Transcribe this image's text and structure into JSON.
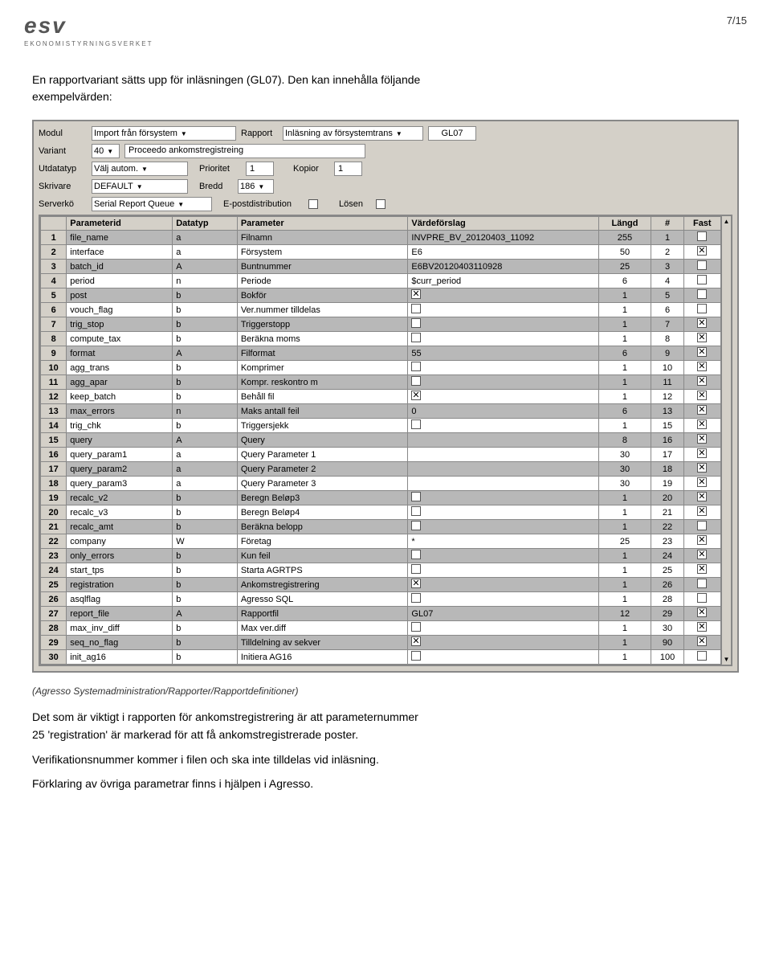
{
  "header": {
    "logo_text": "esv",
    "logo_subtitle": "EKONOMISTYRNINGSVERKET",
    "page_number": "7/15"
  },
  "intro": {
    "line1": "En rapportvariant sätts upp för inläsningen (GL07). Den kan innehålla följande",
    "line2": "exempelvärden:"
  },
  "dialog": {
    "modul_label": "Modul",
    "modul_value": "Import från försystem",
    "rapport_label": "Rapport",
    "rapport_value": "Inläsning av försystemtrans",
    "rapport_code": "GL07",
    "variant_label": "Variant",
    "variant_value": "40",
    "variant_desc": "Proceedo ankomstregistreing",
    "utdatatyp_label": "Utdatatyp",
    "utdatatyp_value": "Välj autom.",
    "prioritet_label": "Prioritet",
    "prioritet_value": "1",
    "kopior_label": "Kopior",
    "kopior_value": "1",
    "skrivare_label": "Skrivare",
    "skrivare_value": "DEFAULT",
    "bredd_label": "Bredd",
    "bredd_value": "186",
    "serverkö_label": "Serverkö",
    "serverkö_value": "Serial Report Queue",
    "epost_label": "E-postdistribution",
    "losen_label": "Lösen"
  },
  "table": {
    "headers": [
      "",
      "Parameterid",
      "Datatyp",
      "Parameter",
      "Värdeförslag",
      "Längd",
      "#",
      "Fast"
    ],
    "rows": [
      {
        "num": "1",
        "paramid": "file_name",
        "dtype": "a",
        "param": "Filnamn",
        "value": "INVPRE_BV_20120403_11092",
        "length": "255",
        "hash": "1",
        "fast": false,
        "dark": true
      },
      {
        "num": "2",
        "paramid": "interface",
        "dtype": "a",
        "param": "Försystem",
        "value": "E6",
        "length": "50",
        "hash": "2",
        "fast": true,
        "dark": false
      },
      {
        "num": "3",
        "paramid": "batch_id",
        "dtype": "A",
        "param": "Buntnummer",
        "value": "E6BV20120403110928",
        "length": "25",
        "hash": "3",
        "fast": false,
        "dark": true
      },
      {
        "num": "4",
        "paramid": "period",
        "dtype": "n",
        "param": "Periode",
        "value": "$curr_period",
        "length": "6",
        "hash": "4",
        "fast": false,
        "dark": false
      },
      {
        "num": "5",
        "paramid": "post",
        "dtype": "b",
        "param": "Bokför",
        "value": "checked",
        "length": "1",
        "hash": "5",
        "fast": false,
        "dark": true
      },
      {
        "num": "6",
        "paramid": "vouch_flag",
        "dtype": "b",
        "param": "Ver.nummer tilldelas",
        "value": "",
        "length": "1",
        "hash": "6",
        "fast": false,
        "dark": false
      },
      {
        "num": "7",
        "paramid": "trig_stop",
        "dtype": "b",
        "param": "Triggerstopp",
        "value": "",
        "length": "1",
        "hash": "7",
        "fast": true,
        "dark": true
      },
      {
        "num": "8",
        "paramid": "compute_tax",
        "dtype": "b",
        "param": "Beräkna moms",
        "value": "",
        "length": "1",
        "hash": "8",
        "fast": true,
        "dark": false
      },
      {
        "num": "9",
        "paramid": "format",
        "dtype": "A",
        "param": "Filformat",
        "value": "55",
        "length": "6",
        "hash": "9",
        "fast": true,
        "dark": true
      },
      {
        "num": "10",
        "paramid": "agg_trans",
        "dtype": "b",
        "param": "Komprimer",
        "value": "",
        "length": "1",
        "hash": "10",
        "fast": true,
        "dark": false
      },
      {
        "num": "11",
        "paramid": "agg_apar",
        "dtype": "b",
        "param": "Kompr. reskontro m",
        "value": "",
        "length": "1",
        "hash": "11",
        "fast": true,
        "dark": true
      },
      {
        "num": "12",
        "paramid": "keep_batch",
        "dtype": "b",
        "param": "Behåll fil",
        "value": "checked",
        "length": "1",
        "hash": "12",
        "fast": true,
        "dark": false
      },
      {
        "num": "13",
        "paramid": "max_errors",
        "dtype": "n",
        "param": "Maks antall feil",
        "value": "0",
        "length": "6",
        "hash": "13",
        "fast": true,
        "dark": true
      },
      {
        "num": "14",
        "paramid": "trig_chk",
        "dtype": "b",
        "param": "Triggersjekk",
        "value": "",
        "length": "1",
        "hash": "15",
        "fast": true,
        "dark": false
      },
      {
        "num": "15",
        "paramid": "query",
        "dtype": "A",
        "param": "Query",
        "value": "",
        "length": "8",
        "hash": "16",
        "fast": true,
        "dark": true
      },
      {
        "num": "16",
        "paramid": "query_param1",
        "dtype": "a",
        "param": "Query Parameter 1",
        "value": "",
        "length": "30",
        "hash": "17",
        "fast": true,
        "dark": false
      },
      {
        "num": "17",
        "paramid": "query_param2",
        "dtype": "a",
        "param": "Query Parameter 2",
        "value": "",
        "length": "30",
        "hash": "18",
        "fast": true,
        "dark": true
      },
      {
        "num": "18",
        "paramid": "query_param3",
        "dtype": "a",
        "param": "Query Parameter 3",
        "value": "",
        "length": "30",
        "hash": "19",
        "fast": true,
        "dark": false
      },
      {
        "num": "19",
        "paramid": "recalc_v2",
        "dtype": "b",
        "param": "Beregn Beløp3",
        "value": "",
        "length": "1",
        "hash": "20",
        "fast": true,
        "dark": true
      },
      {
        "num": "20",
        "paramid": "recalc_v3",
        "dtype": "b",
        "param": "Beregn Beløp4",
        "value": "",
        "length": "1",
        "hash": "21",
        "fast": true,
        "dark": false
      },
      {
        "num": "21",
        "paramid": "recalc_amt",
        "dtype": "b",
        "param": "Beräkna belopp",
        "value": "",
        "length": "1",
        "hash": "22",
        "fast": false,
        "dark": true
      },
      {
        "num": "22",
        "paramid": "company",
        "dtype": "W",
        "param": "Företag",
        "value": "*",
        "length": "25",
        "hash": "23",
        "fast": true,
        "dark": false
      },
      {
        "num": "23",
        "paramid": "only_errors",
        "dtype": "b",
        "param": "Kun feil",
        "value": "",
        "length": "1",
        "hash": "24",
        "fast": true,
        "dark": true
      },
      {
        "num": "24",
        "paramid": "start_tps",
        "dtype": "b",
        "param": "Starta AGRTPS",
        "value": "",
        "length": "1",
        "hash": "25",
        "fast": true,
        "dark": false
      },
      {
        "num": "25",
        "paramid": "registration",
        "dtype": "b",
        "param": "Ankomstregistrering",
        "value": "checked",
        "length": "1",
        "hash": "26",
        "fast": false,
        "dark": true
      },
      {
        "num": "26",
        "paramid": "asqlflag",
        "dtype": "b",
        "param": "Agresso SQL",
        "value": "",
        "length": "1",
        "hash": "28",
        "fast": false,
        "dark": false
      },
      {
        "num": "27",
        "paramid": "report_file",
        "dtype": "A",
        "param": "Rapportfil",
        "value": "GL07",
        "length": "12",
        "hash": "29",
        "fast": true,
        "dark": true
      },
      {
        "num": "28",
        "paramid": "max_inv_diff",
        "dtype": "b",
        "param": "Max ver.diff",
        "value": "",
        "length": "1",
        "hash": "30",
        "fast": true,
        "dark": false
      },
      {
        "num": "29",
        "paramid": "seq_no_flag",
        "dtype": "b",
        "param": "Tilldelning av sekver",
        "value": "checked",
        "length": "1",
        "hash": "90",
        "fast": true,
        "dark": true
      },
      {
        "num": "30",
        "paramid": "init_ag16",
        "dtype": "b",
        "param": "Initiera AG16",
        "value": "",
        "length": "1",
        "hash": "100",
        "fast": false,
        "dark": false
      }
    ]
  },
  "caption": "(Agresso Systemadministration/Rapporter/Rapportdefinitioner)",
  "body_paragraphs": [
    "Det som är viktigt i rapporten för ankomstregistrering är att parameternummer",
    "25 'registration' är markerad för att få ankomstregistrerade poster.",
    "Verifikationsnummer kommer i filen och ska inte tilldelas vid inläsning.",
    "Förklaring av övriga parametrar finns i hjälpen i Agresso."
  ]
}
